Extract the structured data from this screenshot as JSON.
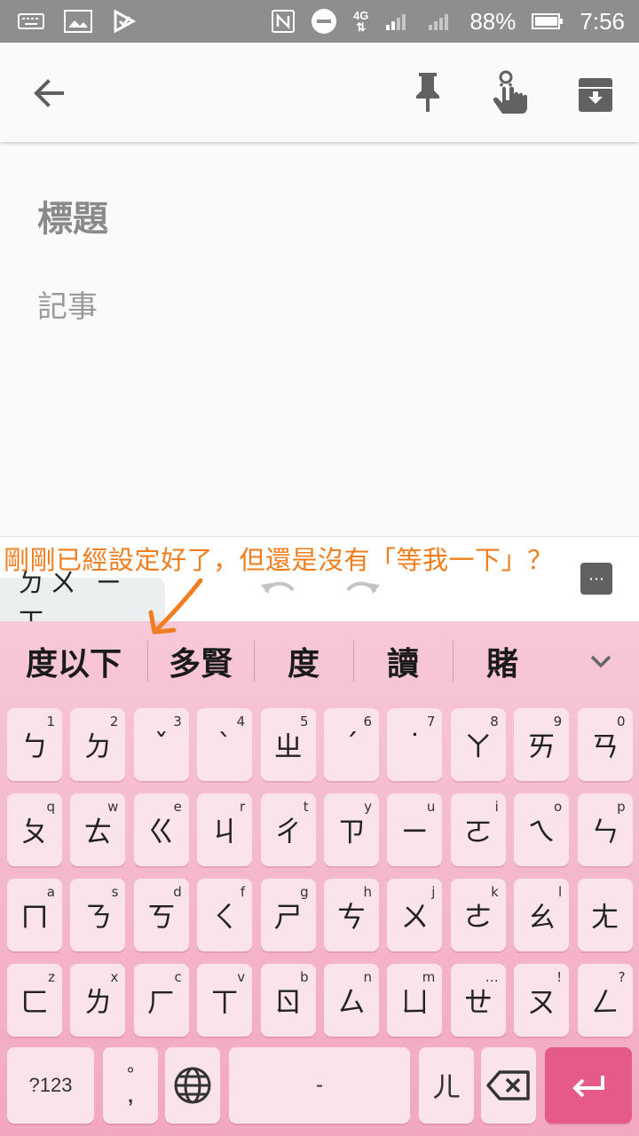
{
  "status_bar": {
    "battery_percent": "88%",
    "time": "7:56",
    "network": "4G",
    "icons": [
      "keyboard-icon",
      "image-icon",
      "play-check-icon",
      "nfc-icon",
      "do-not-disturb-icon",
      "4g-icon",
      "signal-icon",
      "signal-icon",
      "battery-icon"
    ]
  },
  "appbar": {
    "icons": [
      "back-arrow-icon",
      "pin-icon",
      "reminder-hand-icon",
      "archive-icon"
    ]
  },
  "note": {
    "title_placeholder": "標題",
    "body_placeholder": "記事"
  },
  "composition": {
    "text": "ㄉㄨ ㄧ ㄒ",
    "more_label": "⋯"
  },
  "annotation": {
    "text": "剛剛已經設定好了，但還是沒有「等我一下」？"
  },
  "candidates": [
    "度以下",
    "多賢",
    "度",
    "讀",
    "賭"
  ],
  "keyboard": {
    "rows": [
      [
        [
          "ㄅ",
          "1"
        ],
        [
          "ㄉ",
          "2"
        ],
        [
          "ˇ",
          "3"
        ],
        [
          "ˋ",
          "4"
        ],
        [
          "ㄓ",
          "5"
        ],
        [
          "ˊ",
          "6"
        ],
        [
          "˙",
          "7"
        ],
        [
          "ㄚ",
          "8"
        ],
        [
          "ㄞ",
          "9"
        ],
        [
          "ㄢ",
          "0"
        ]
      ],
      [
        [
          "ㄆ",
          "q"
        ],
        [
          "ㄊ",
          "w"
        ],
        [
          "ㄍ",
          "e"
        ],
        [
          "ㄐ",
          "r"
        ],
        [
          "ㄔ",
          "t"
        ],
        [
          "ㄗ",
          "y"
        ],
        [
          "ㄧ",
          "u"
        ],
        [
          "ㄛ",
          "i"
        ],
        [
          "ㄟ",
          "o"
        ],
        [
          "ㄣ",
          "p"
        ]
      ],
      [
        [
          "ㄇ",
          "a"
        ],
        [
          "ㄋ",
          "s"
        ],
        [
          "ㄎ",
          "d"
        ],
        [
          "ㄑ",
          "f"
        ],
        [
          "ㄕ",
          "g"
        ],
        [
          "ㄘ",
          "h"
        ],
        [
          "ㄨ",
          "j"
        ],
        [
          "ㄜ",
          "k"
        ],
        [
          "ㄠ",
          "l"
        ],
        [
          "ㄤ",
          ""
        ]
      ],
      [
        [
          "ㄈ",
          "z"
        ],
        [
          "ㄌ",
          "x"
        ],
        [
          "ㄏ",
          "c"
        ],
        [
          "ㄒ",
          "v"
        ],
        [
          "ㄖ",
          "b"
        ],
        [
          "ㄙ",
          "n"
        ],
        [
          "ㄩ",
          "m"
        ],
        [
          "ㄝ",
          "…"
        ],
        [
          "ㄡ",
          "!"
        ],
        [
          "ㄥ",
          "?"
        ]
      ]
    ],
    "symbols_label": "?123",
    "punct_top": "°",
    "punct_bottom": ",",
    "space_label": "-",
    "er_label": "ㄦ"
  }
}
